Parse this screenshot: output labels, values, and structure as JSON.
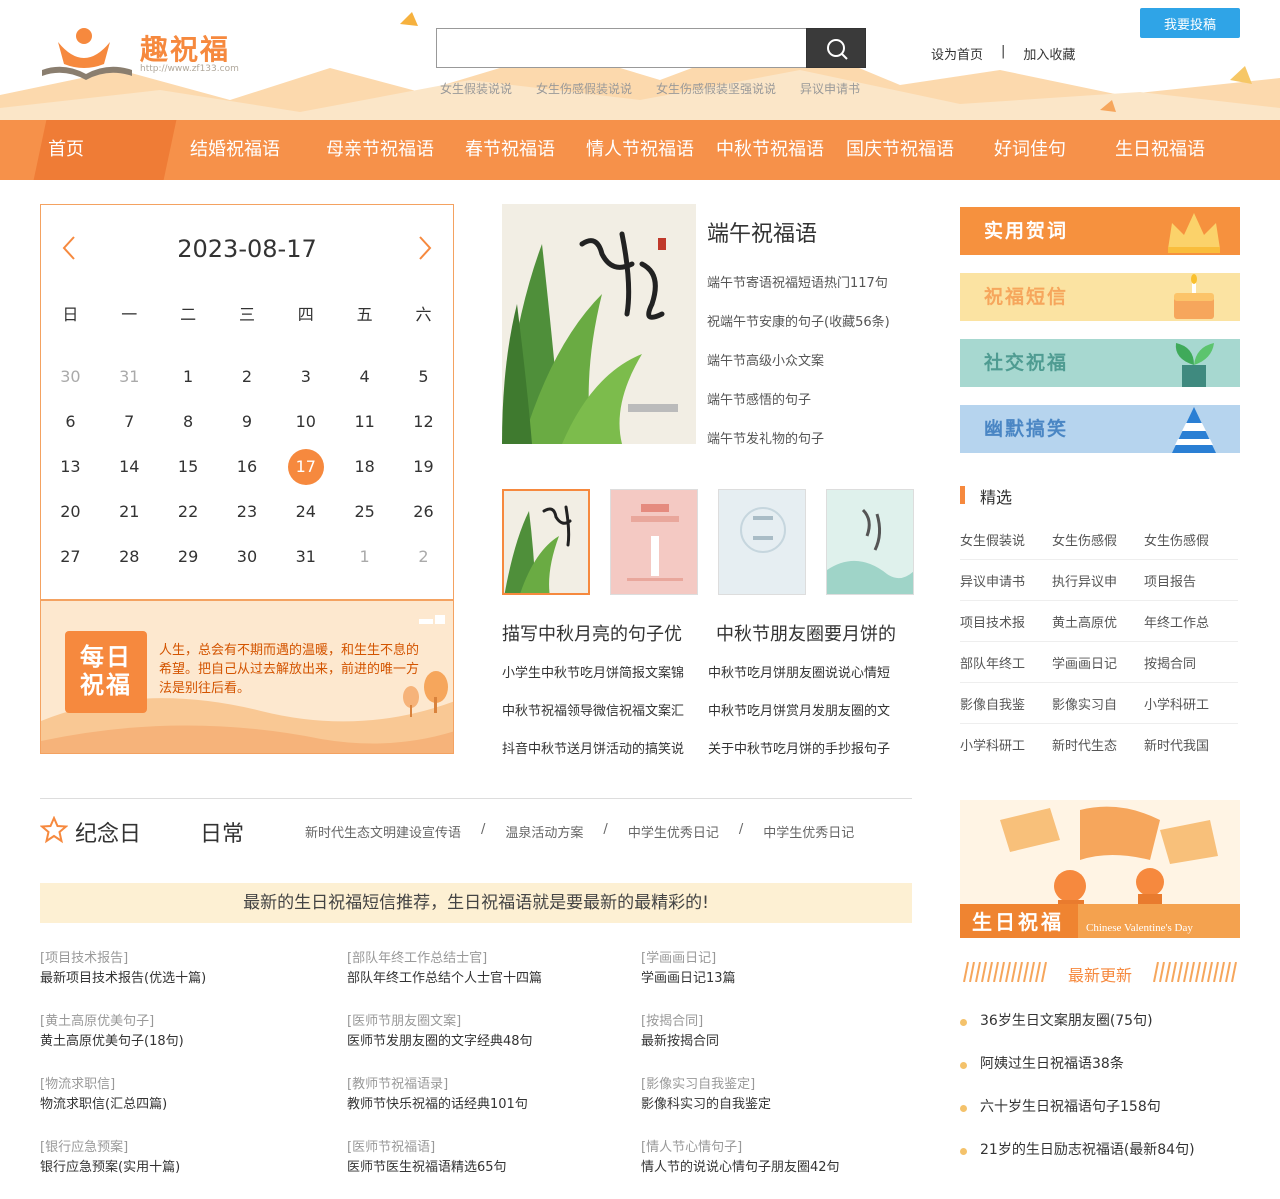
{
  "header": {
    "logo_title": "趣祝福",
    "logo_url": "http://www.zf133.com",
    "search_placeholder": "",
    "hot_links": [
      "女生假装说说",
      "女生伤感假装说说",
      "女生伤感假装坚强说说",
      "异议申请书"
    ],
    "top_links": [
      "设为首页",
      "|",
      "加入收藏"
    ],
    "submit_label": "我要投稿"
  },
  "nav": [
    "首页",
    "结婚祝福语",
    "母亲节祝福语",
    "春节祝福语",
    "情人节祝福语",
    "中秋节祝福语",
    "国庆节祝福语",
    "好词佳句",
    "生日祝福语"
  ],
  "calendar": {
    "date": "2023-08-17",
    "weekdays": [
      "日",
      "一",
      "二",
      "三",
      "四",
      "五",
      "六"
    ],
    "weeks": [
      [
        "30",
        "31",
        "1",
        "2",
        "3",
        "4",
        "5"
      ],
      [
        "6",
        "7",
        "8",
        "9",
        "10",
        "11",
        "12"
      ],
      [
        "13",
        "14",
        "15",
        "16",
        "17",
        "18",
        "19"
      ],
      [
        "20",
        "21",
        "22",
        "23",
        "24",
        "25",
        "26"
      ],
      [
        "27",
        "28",
        "29",
        "30",
        "31",
        "1",
        "2"
      ]
    ]
  },
  "daily": {
    "badge_line1": "每日",
    "badge_line2": "祝福",
    "text": "人生，总会有不期而遇的温暖，和生生不息的希望。把自己从过去解放出来，前进的唯一方法是别往后看。"
  },
  "feature": {
    "title": "端午祝福语",
    "items": [
      "端午节寄语祝福短语热门117句",
      "祝端午节安康的句子(收藏56条)",
      "端午节高级小众文案",
      "端午节感悟的句子",
      "端午节发礼物的句子"
    ]
  },
  "mid": {
    "titles": [
      "描写中秋月亮的句子优",
      "中秋节朋友圈要月饼的"
    ],
    "rows": [
      [
        "小学生中秋节吃月饼简报文案锦",
        "中秋节吃月饼朋友圈说说心情短"
      ],
      [
        "中秋节祝福领导微信祝福文案汇",
        "中秋节吃月饼赏月发朋友圈的文"
      ],
      [
        "抖音中秋节送月饼活动的搞笑说",
        "关于中秋节吃月饼的手抄报句子"
      ]
    ]
  },
  "side_cats": [
    {
      "label": "实用贺词",
      "color": "#f6913e"
    },
    {
      "label": "祝福短信",
      "color": "#fbe3a2"
    },
    {
      "label": "社交祝福",
      "color": "#a7d8d0"
    },
    {
      "label": "幽默搞笑",
      "color": "#b6d4ee"
    }
  ],
  "picks": {
    "title": "精选",
    "rows": [
      [
        "女生假装说",
        "女生伤感假",
        "女生伤感假"
      ],
      [
        "异议申请书",
        "执行异议申",
        "项目报告"
      ],
      [
        "项目技术报",
        "黄土高原优",
        "年终工作总"
      ],
      [
        "部队年终工",
        "学画画日记",
        "按揭合同"
      ],
      [
        "影像自我鉴",
        "影像实习自",
        "小学科研工"
      ],
      [
        "小学科研工",
        "新时代生态",
        "新时代我国"
      ]
    ]
  },
  "tabs": {
    "a": "纪念日",
    "b": "日常",
    "links": [
      "新时代生态文明建设宣传语",
      "/",
      "温泉活动方案",
      "/",
      "中学生优秀日记",
      "/",
      "中学生优秀日记"
    ]
  },
  "banner": "最新的生日祝福短信推荐，生日祝福语就是要最新的最精彩的!",
  "articles": [
    [
      [
        "[项目技术报告]",
        "最新项目技术报告(优选十篇)"
      ],
      [
        "[部队年终工作总结士官]",
        "部队年终工作总结个人士官十四篇"
      ],
      [
        "[学画画日记]",
        "学画画日记13篇"
      ]
    ],
    [
      [
        "[黄土高原优美句子]",
        "黄土高原优美句子(18句)"
      ],
      [
        "[医师节朋友圈文案]",
        "医师节发朋友圈的文字经典48句"
      ],
      [
        "[按揭合同]",
        "最新按揭合同"
      ]
    ],
    [
      [
        "[物流求职信]",
        "物流求职信(汇总四篇)"
      ],
      [
        "[教师节祝福语录]",
        "教师节快乐祝福的话经典101句"
      ],
      [
        "[影像实习自我鉴定]",
        "影像科实习的自我鉴定"
      ]
    ],
    [
      [
        "[银行应急预案]",
        "银行应急预案(实用十篇)"
      ],
      [
        "[医师节祝福语]",
        "医师节医生祝福语精选65句"
      ],
      [
        "[情人节心情句子]",
        "情人节的说说心情句子朋友圈42句"
      ]
    ]
  ],
  "side_banner": {
    "title": "生日祝福",
    "sub": "Chinese Valentine's Day"
  },
  "latest": {
    "title": "最新更新",
    "items": [
      "36岁生日文案朋友圈(75句)",
      "阿姨过生日祝福语38条",
      "六十岁生日祝福语句子158句",
      "21岁的生日励志祝福语(最新84句)"
    ]
  }
}
